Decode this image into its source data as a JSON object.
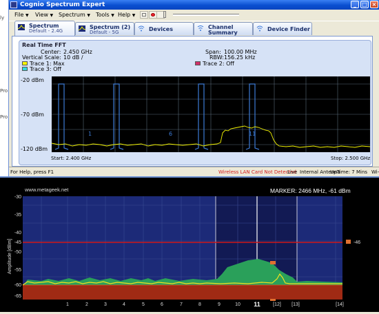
{
  "left_strip": {
    "fragments": [
      "ly",
      "Pro",
      "Pro"
    ]
  },
  "window": {
    "title": "Cognio Spectrum Expert",
    "caption_buttons": [
      "minimize",
      "maximize",
      "close"
    ]
  },
  "menubar": {
    "items": [
      "File",
      "View",
      "Spectrum",
      "Tools",
      "Help"
    ]
  },
  "tabs": [
    {
      "title": "Spectrum",
      "subtitle": "Default - 2.4G",
      "icon": "spectrum-icon",
      "active": true
    },
    {
      "title": "Spectrum (2)",
      "subtitle": "Default - 5G",
      "icon": "spectrum-icon",
      "active": false
    },
    {
      "title": "Devices",
      "subtitle": "",
      "icon": "wifi-icon",
      "active": false
    },
    {
      "title": "Channel",
      "subtitle": "Summary",
      "icon": "channel-icon",
      "active": false
    },
    {
      "title": "Device Finder",
      "subtitle": "",
      "icon": "finder-icon",
      "active": false
    }
  ],
  "realtime_fft": {
    "title": "Real Time FFT",
    "center_label": "Center:",
    "center_value": "2.450 GHz",
    "span_label": "Span:",
    "span_value": "100.00 MHz",
    "vscale_label": "Vertical Scale:",
    "vscale_value": "10 dB /",
    "rbw_label": "RBW:",
    "rbw_value": "156.25 kHz",
    "trace1": "Trace 1: Max",
    "trace2": "Trace 2: Off",
    "trace3": "Trace 3: Off",
    "trace1_color": "#f5f500",
    "trace2_color": "#d0306a",
    "trace3_color": "#30d8e0",
    "y_ticks": [
      "-20 dBm",
      "-70 dBm",
      "-120 dBm"
    ],
    "start": "Start: 2.400 GHz",
    "stop": "Stop: 2.500 GHz",
    "channel_markers": [
      "1",
      "6",
      "11"
    ]
  },
  "statusbar": {
    "help": "For Help, press F1",
    "wireless": "Wireless LAN Card Not Detected",
    "live": "Live",
    "antenna": "Internal Antenna",
    "uptime": "UpTime: 7 Mins",
    "wifi": "Wi-Fi",
    "wireless_color": "#d42020"
  },
  "metageek": {
    "site": "www.metageek.net",
    "marker": "MARKER: 2466 MHz, -61 dBm",
    "ylabel": "Amplitude [dBm]",
    "y_ticks": [
      "-30",
      "-35",
      "-40",
      "-45",
      "-50",
      "-55",
      "-60",
      "-65"
    ],
    "x_ticks": [
      "1",
      "2",
      "3",
      "4",
      "5",
      "6",
      "7",
      "8",
      "9",
      "10",
      "11",
      "[12]",
      "[13]",
      "[14]"
    ],
    "threshold_label": "-46",
    "threshold_color": "#d01818",
    "bg_color": "#1c2a78",
    "green_color": "#2aa05a",
    "floor_color": "#a02a14"
  }
}
